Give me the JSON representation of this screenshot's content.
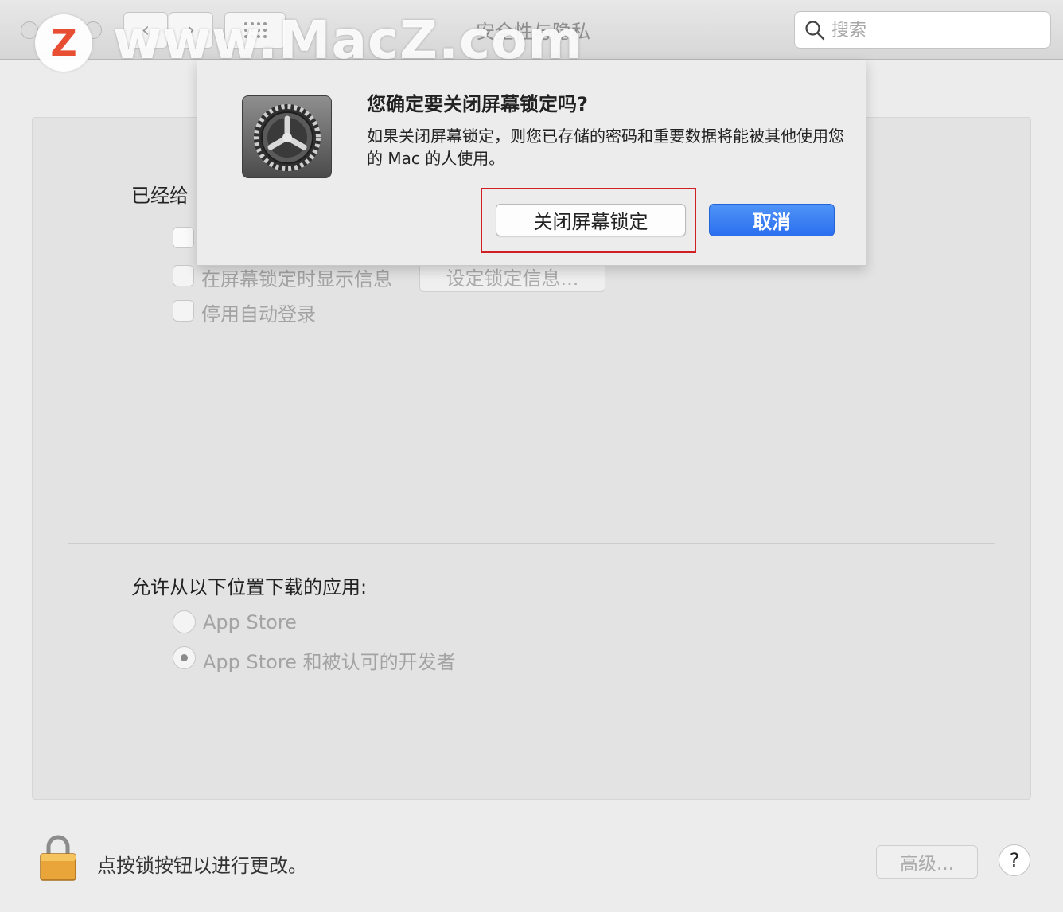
{
  "window": {
    "title": "安全性与隐私",
    "search_placeholder": "搜索",
    "back_glyph": "‹",
    "forward_glyph": "›",
    "grid_glyph": "⋮⋮⋮"
  },
  "watermark": {
    "logo_letter": "Z",
    "text": "www.MacZ.com"
  },
  "general": {
    "password_label": "已经给",
    "checkbox_password_label": "",
    "show_message_label": "在屏幕锁定时显示信息",
    "set_lock_message_button": "设定锁定信息...",
    "disable_autologin_label": "停用自动登录"
  },
  "downloads": {
    "heading": "允许从以下位置下载的应用:",
    "options": [
      {
        "label": "App Store",
        "selected": false
      },
      {
        "label": "App Store 和被认可的开发者",
        "selected": true
      }
    ]
  },
  "footer": {
    "lock_text": "点按锁按钮以进行更改。",
    "advanced_button": "高级...",
    "help_button": "?"
  },
  "dialog": {
    "title": "您确定要关闭屏幕锁定吗?",
    "message": "如果关闭屏幕锁定，则您已存储的密码和重要数据将能被其他使用您的 Mac 的人使用。",
    "confirm_button": "关闭屏幕锁定",
    "cancel_button": "取消",
    "highlight_color": "#d02024",
    "default_button_color": "#2c6ff0"
  }
}
